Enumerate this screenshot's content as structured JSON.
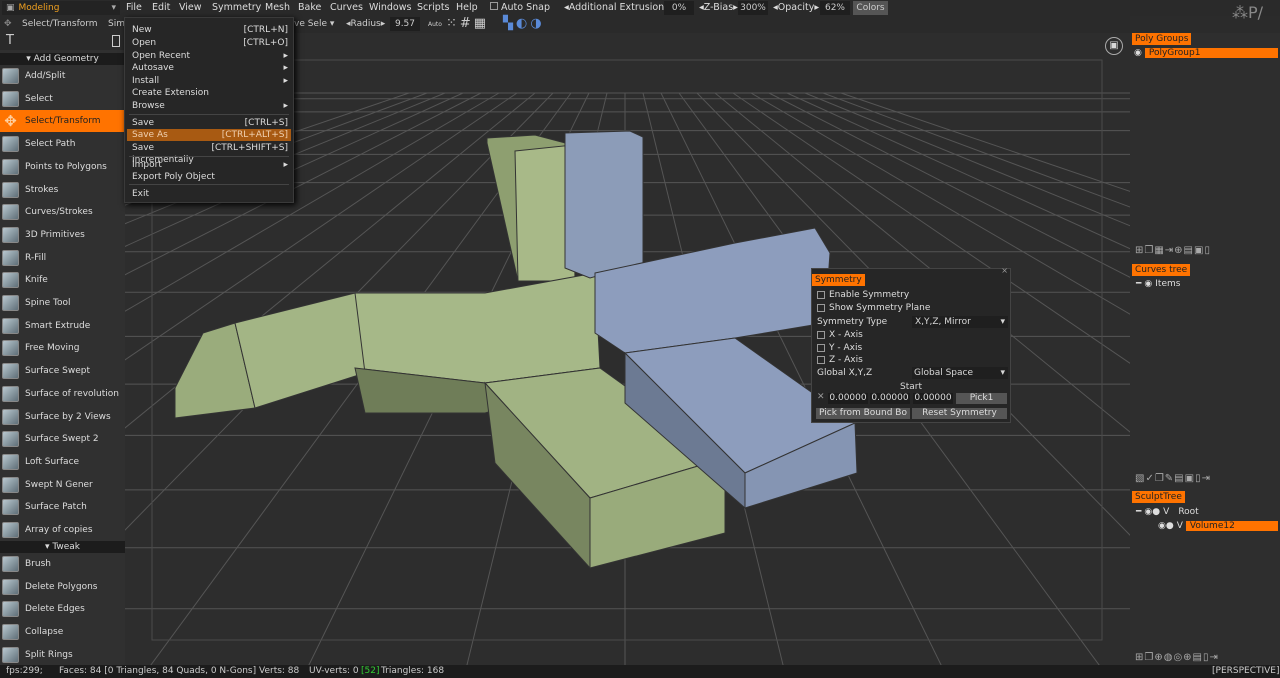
{
  "app": {
    "mode": "Modeling"
  },
  "menu": [
    "File",
    "Edit",
    "View",
    "Symmetry",
    "Mesh",
    "Bake",
    "Curves",
    "Windows",
    "Scripts",
    "Help"
  ],
  "toolbar": {
    "auto_snap": "Auto Snap",
    "additional_extrusion_label": "Additional Extrusion",
    "additional_extrusion": "0%",
    "zbias_label": "Z-Bias",
    "zbias": "300%",
    "opacity_label": "Opacity",
    "opacity": "62%",
    "colors": "Colors",
    "tool": "Select/Transform",
    "sim": "Sim",
    "selection": "ve Sele",
    "radius_label": "Radius",
    "radius": "9.57",
    "auto": "Auto"
  },
  "file_menu": [
    {
      "label": "New",
      "shortcut": "[CTRL+N]"
    },
    {
      "label": "Open",
      "shortcut": "[CTRL+O]"
    },
    {
      "label": "Open Recent",
      "shortcut": "▸"
    },
    {
      "label": "Autosave",
      "shortcut": "▸"
    },
    {
      "label": "Install",
      "shortcut": "▸"
    },
    {
      "label": "Create Extension",
      "shortcut": ""
    },
    {
      "label": "Browse",
      "shortcut": "▸"
    },
    {
      "label": "Save",
      "shortcut": "[CTRL+S]"
    },
    {
      "label": "Save As",
      "shortcut": "[CTRL+ALT+S]"
    },
    {
      "label": "Save Incrementally",
      "shortcut": "[CTRL+SHIFT+S]"
    },
    {
      "label": "Import",
      "shortcut": "▸"
    },
    {
      "label": "Export Poly Object",
      "shortcut": ""
    },
    {
      "label": "Exit",
      "shortcut": ""
    }
  ],
  "left_panel": {
    "add_geometry": "Add Geometry",
    "tools": [
      "Add/Split",
      "Select",
      "Select/Transform",
      "Select Path",
      "Points to Polygons",
      "Strokes",
      "Curves/Strokes",
      "3D Primitives",
      "R-Fill",
      "Knife",
      "Spine Tool",
      "Smart Extrude",
      "Free Moving",
      "Surface Swept",
      "Surface of revolution",
      "Surface by 2 Views",
      "Surface Swept 2",
      "Loft Surface",
      "Swept N Gener",
      "Surface Patch",
      "Array of copies"
    ],
    "tweak": "Tweak",
    "tweak_tools": [
      "Brush",
      "Delete Polygons",
      "Delete Edges",
      "Collapse",
      "Split Rings"
    ]
  },
  "symmetry": {
    "title": "Symmetry",
    "enable": "Enable Symmetry",
    "show_plane": "Show Symmetry Plane",
    "type_label": "Symmetry Type",
    "type_value": "X,Y,Z, Mirror",
    "x_axis": "X - Axis",
    "y_axis": "Y - Axis",
    "z_axis": "Z - Axis",
    "global_label": "Global X,Y,Z",
    "global_value": "Global Space",
    "start": "Start",
    "x": "0.00000",
    "y": "0.00000",
    "z": "0.00000",
    "pick1": "Pick1",
    "pick_bound": "Pick from Bound Bo",
    "reset": "Reset Symmetry"
  },
  "right_panel": {
    "poly_groups": "Poly Groups",
    "polygroup1": "PolyGroup1",
    "curves_tree": "Curves tree",
    "items": "Items",
    "sculpt_tree": "SculptTree",
    "root": "Root",
    "volume": "Volume12",
    "v": "V"
  },
  "status": {
    "fps": "fps:299;",
    "faces": "Faces: 84 [0 Triangles, 84 Quads, 0 N-Gons]",
    "verts": "Verts: 88",
    "uv_verts": "UV-verts: 0",
    "uv_count": "[52]",
    "triangles": "Triangles: 168",
    "view": "[PERSPECTIVE]"
  }
}
